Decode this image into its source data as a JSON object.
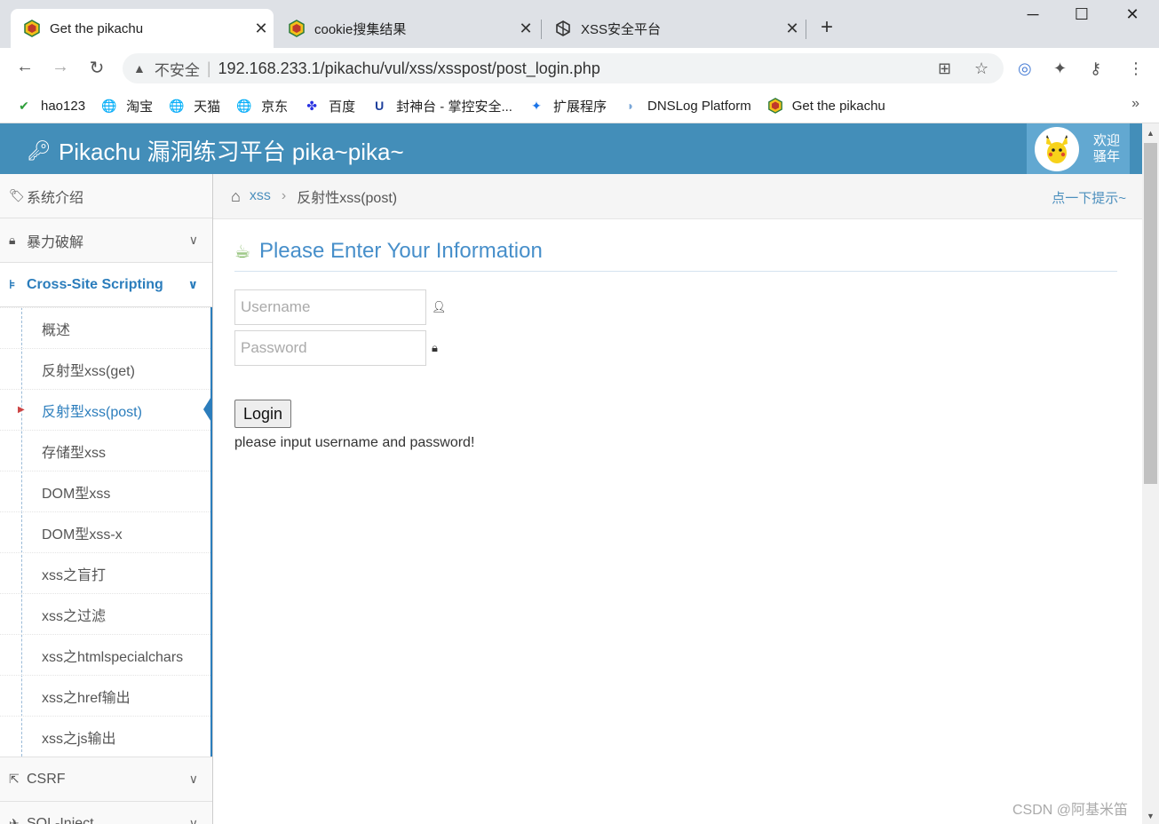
{
  "browser": {
    "tabs": [
      {
        "title": "Get the pikachu",
        "active": true
      },
      {
        "title": "cookie搜集结果",
        "active": false
      },
      {
        "title": "XSS安全平台",
        "active": false
      }
    ],
    "address": {
      "security_label": "不安全",
      "url": "192.168.233.1/pikachu/vul/xss/xsspost/post_login.php"
    },
    "bookmarks": [
      {
        "label": "hao123",
        "icon": "hao123-icon"
      },
      {
        "label": "淘宝",
        "icon": "globe-icon"
      },
      {
        "label": "天猫",
        "icon": "globe-icon"
      },
      {
        "label": "京东",
        "icon": "globe-icon"
      },
      {
        "label": "百度",
        "icon": "baidu-paw-icon"
      },
      {
        "label": "封神台 - 掌控安全...",
        "icon": "shield-icon"
      },
      {
        "label": "扩展程序",
        "icon": "puzzle-icon"
      },
      {
        "label": "DNSLog Platform",
        "icon": "dnslog-icon"
      },
      {
        "label": "Get the pikachu",
        "icon": "pikachu-favicon-icon"
      }
    ],
    "bookmarks_more": "»"
  },
  "header": {
    "brand": "Pikachu 漏洞练习平台 pika~pika~",
    "welcome_line1": "欢迎",
    "welcome_line2": "骚年"
  },
  "sidebar": {
    "items": [
      {
        "label": "系统介绍",
        "icon": "tags-icon"
      },
      {
        "label": "暴力破解",
        "icon": "lock-icon"
      },
      {
        "label": "Cross-Site Scripting",
        "icon": "sitemap-icon"
      }
    ],
    "xss_sub": [
      "概述",
      "反射型xss(get)",
      "反射型xss(post)",
      "存储型xss",
      "DOM型xss",
      "DOM型xss-x",
      "xss之盲打",
      "xss之过滤",
      "xss之htmlspecialchars",
      "xss之href输出",
      "xss之js输出"
    ],
    "bottom_items": [
      {
        "label": "CSRF",
        "icon": "share-icon"
      },
      {
        "label": "SQL-Inject",
        "icon": "plane-icon"
      }
    ]
  },
  "breadcrumb": {
    "link": "xss",
    "current": "反射性xss(post)",
    "hint": "点一下提示~"
  },
  "form": {
    "heading": "Please Enter Your Information",
    "username_placeholder": "Username",
    "password_placeholder": "Password",
    "login_label": "Login",
    "message": "please input username and password!"
  },
  "watermark": "CSDN @阿基米笛",
  "colors": {
    "header_bg": "#438eb9",
    "accent": "#2b7dbc",
    "heading": "#478fca"
  }
}
